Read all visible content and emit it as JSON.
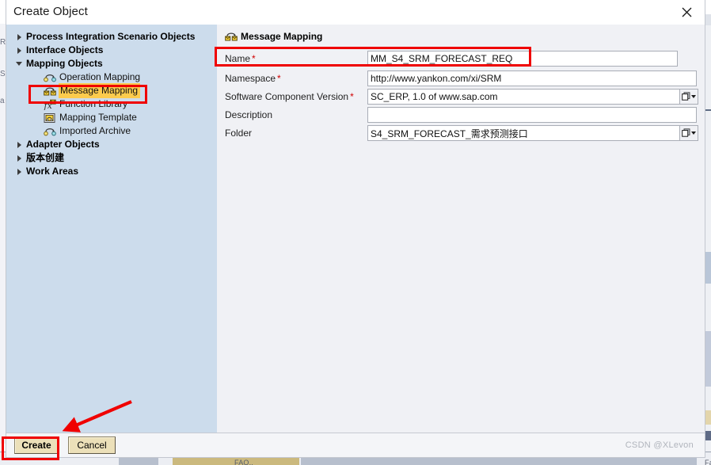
{
  "window": {
    "title": "Create Object",
    "close_icon": "close-icon"
  },
  "tree": {
    "items": [
      {
        "label": "Process Integration Scenario Objects",
        "level": 0,
        "state": "collapsed",
        "icon": "",
        "selected": false
      },
      {
        "label": "Interface Objects",
        "level": 0,
        "state": "collapsed",
        "icon": "",
        "selected": false
      },
      {
        "label": "Mapping Objects",
        "level": 0,
        "state": "expanded",
        "icon": "",
        "selected": false
      },
      {
        "label": "Operation Mapping",
        "level": 1,
        "state": "leaf",
        "icon": "operation-mapping-icon",
        "selected": false
      },
      {
        "label": "Message Mapping",
        "level": 1,
        "state": "leaf",
        "icon": "message-mapping-icon",
        "selected": true
      },
      {
        "label": "Function Library",
        "level": 1,
        "state": "leaf",
        "icon": "function-library-icon",
        "selected": false
      },
      {
        "label": "Mapping Template",
        "level": 1,
        "state": "leaf",
        "icon": "mapping-template-icon",
        "selected": false
      },
      {
        "label": "Imported Archive",
        "level": 1,
        "state": "leaf",
        "icon": "imported-archive-icon",
        "selected": false
      },
      {
        "label": "Adapter Objects",
        "level": 0,
        "state": "collapsed",
        "icon": "",
        "selected": false
      },
      {
        "label": "版本创建",
        "level": 0,
        "state": "collapsed",
        "icon": "",
        "selected": false
      },
      {
        "label": "Work Areas",
        "level": 0,
        "state": "collapsed",
        "icon": "",
        "selected": false
      }
    ]
  },
  "form": {
    "header": "Message Mapping",
    "header_icon": "message-mapping-icon",
    "fields": [
      {
        "label": "Name",
        "required": true,
        "value": "MM_S4_SRM_FORECAST_REQ",
        "placeholder": "",
        "has_browse": false,
        "width": "narrow"
      },
      {
        "label": "Namespace",
        "required": true,
        "value": "http://www.yankon.com/xi/SRM",
        "placeholder": "",
        "has_browse": false,
        "width": "wide"
      },
      {
        "label": "Software Component Version",
        "required": true,
        "value": "SC_ERP, 1.0 of www.sap.com",
        "placeholder": "",
        "has_browse": true,
        "width": "wide"
      },
      {
        "label": "Description",
        "required": false,
        "value": "",
        "placeholder": "",
        "has_browse": false,
        "width": "wide"
      },
      {
        "label": "Folder",
        "required": false,
        "value": "S4_SRM_FORECAST_需求预测接口",
        "placeholder": "",
        "has_browse": true,
        "width": "wide"
      }
    ]
  },
  "footer": {
    "create_label": "Create",
    "cancel_label": "Cancel"
  },
  "annotations": {
    "accent_color": "#ef0000",
    "arrow": "red-arrow-annotation",
    "highlight_name_field": true,
    "highlight_message_mapping": true,
    "highlight_create_button": true
  },
  "watermark": {
    "text": "CSDN @XLevon"
  },
  "underlay": {
    "left_ghost_chars": [
      "R",
      "S",
      "a"
    ],
    "bottom_ghost_left": "FAQ..",
    "bottom_ghost_right": "Fault Message Type"
  },
  "colors": {
    "tree_bg": "#ccdcec",
    "form_bg": "#f0f1f5",
    "selection": "#fccb4d",
    "annotation": "#ef0000",
    "button_face": "#ece0b9"
  }
}
